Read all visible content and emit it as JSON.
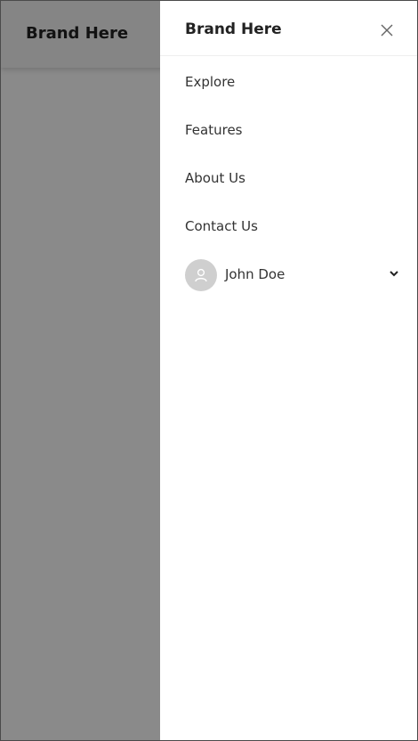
{
  "page": {
    "brand": "Brand Here"
  },
  "drawer": {
    "brand": "Brand Here",
    "close_icon": "close-icon",
    "nav_items": [
      {
        "label": "Explore"
      },
      {
        "label": "Features"
      },
      {
        "label": "About Us"
      },
      {
        "label": "Contact Us"
      }
    ],
    "user": {
      "name": "John Doe",
      "avatar_icon": "user-icon",
      "menu_icon": "chevron-down-icon"
    }
  },
  "colors": {
    "overlay": "#000000",
    "drawer_bg": "#ffffff",
    "text": "#333333",
    "avatar_bg": "#cfcfcf"
  }
}
